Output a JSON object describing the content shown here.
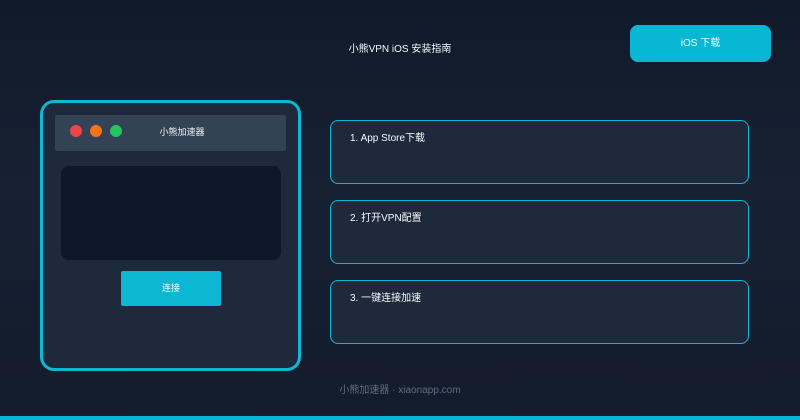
{
  "header": {
    "title": "小熊VPN iOS 安装指南",
    "ios_button_label": "iOS 下载"
  },
  "device_window": {
    "title": "小熊加速器",
    "primary_button_label": "连接"
  },
  "steps": [
    {
      "label": "1. App Store下载"
    },
    {
      "label": "2. 打开VPN配置"
    },
    {
      "label": "3. 一键连接加速"
    }
  ],
  "footer": {
    "text": "小熊加速器 · xiaonapp.com"
  },
  "colors": {
    "accent": "#06b6d4",
    "background_top": "#111a2b",
    "panel": "#1e293b",
    "dark_panel": "#0f172a",
    "red": "#ef4444",
    "orange": "#f97316",
    "green": "#22c55e"
  }
}
